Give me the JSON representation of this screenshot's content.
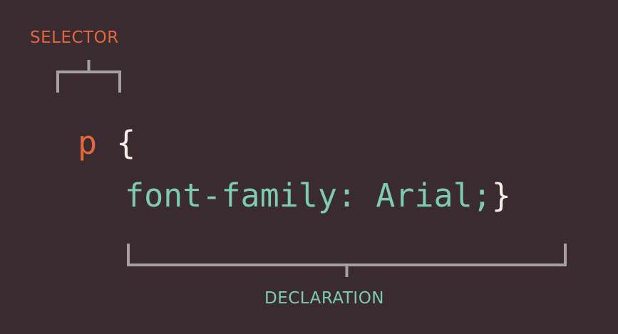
{
  "labels": {
    "selector": "SELECTOR",
    "declaration": "DECLARATION"
  },
  "code": {
    "selector": "p",
    "open_brace": "{",
    "declaration": "font-family: Arial;",
    "close_brace": "}"
  },
  "colors": {
    "background": "#3a2b30",
    "selector": "#e3673e",
    "declaration": "#7ecbb1",
    "brace": "#f4efe9",
    "bracket": "#a5a0a2"
  }
}
